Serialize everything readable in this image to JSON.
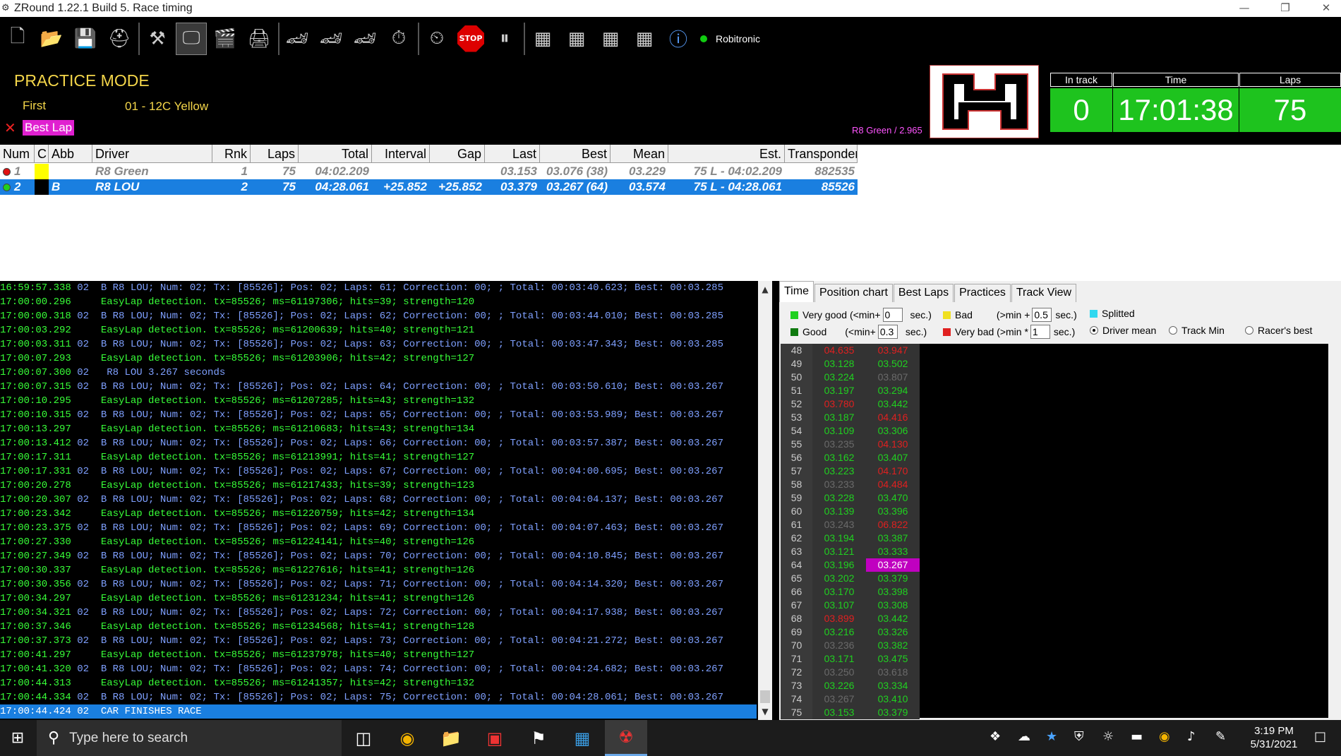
{
  "window": {
    "title": "ZRound 1.22.1 Build 5. Race timing"
  },
  "toolbar": {
    "icons": [
      "new-icon",
      "open-folder-icon",
      "save-icon",
      "helmet-icon",
      "hammer-icon",
      "monitor-icon",
      "clapper-icon",
      "printer-icon",
      "car-chip-icon",
      "car-stack-icon",
      "car-settings-icon",
      "car-timer-icon",
      "stopwatch-icon"
    ],
    "stop_label": "STOP",
    "user": "Robitronic"
  },
  "header": {
    "mode": "PRACTICE MODE",
    "first_label": "First",
    "first_value": "01 - 12C Yellow",
    "best_lap_label": "Best Lap",
    "best_lap_info": "R8 Green / 2.965",
    "in_track_label": "In track",
    "in_track_value": "0",
    "time_label": "Time",
    "time_value": "17:01:38",
    "laps_label": "Laps",
    "laps_value": "75"
  },
  "grid": {
    "columns": [
      "Num",
      "C",
      "Abb",
      "Driver",
      "Rnk",
      "Laps",
      "Total",
      "Interval",
      "Gap",
      "Last",
      "Best",
      "Mean",
      "Est.",
      "Transponder"
    ],
    "rows": [
      {
        "num": "1",
        "color": "#ffff00",
        "abb": "",
        "driver": "R8 Green",
        "rnk": "1",
        "laps": "75",
        "total": "04:02.209",
        "interval": "",
        "gap": "",
        "last": "03.153",
        "best": "03.076 (38)",
        "mean": "03.229",
        "est": "75 L - 04:02.209",
        "transponder": "882535",
        "status": "#e01010",
        "selected": false
      },
      {
        "num": "2",
        "color": "#000000",
        "abb": "B",
        "driver": "R8 LOU",
        "rnk": "2",
        "laps": "75",
        "total": "04:28.061",
        "interval": "+25.852",
        "gap": "+25.852",
        "last": "03.379",
        "best": "03.267 (64)",
        "mean": "03.574",
        "est": "75 L - 04:28.061",
        "transponder": "85526",
        "status": "#20d020",
        "selected": true
      }
    ]
  },
  "log": [
    {
      "t": "16:59:57.338",
      "m": " 02  B R8 LOU; Num: 02; Tx: [85526]; Pos: 02; Laps: 61; Correction: 00; ; Total: 00:03:40.623; Best: 00:03.285",
      "k": 1
    },
    {
      "t": "17:00:00.296",
      "m": "     EasyLap detection. tx=85526; ms=61197306; hits=39; strength=120",
      "k": 2
    },
    {
      "t": "17:00:00.318",
      "m": " 02  B R8 LOU; Num: 02; Tx: [85526]; Pos: 02; Laps: 62; Correction: 00; ; Total: 00:03:44.010; Best: 00:03.285",
      "k": 1
    },
    {
      "t": "17:00:03.292",
      "m": "     EasyLap detection. tx=85526; ms=61200639; hits=40; strength=121",
      "k": 2
    },
    {
      "t": "17:00:03.311",
      "m": " 02  B R8 LOU; Num: 02; Tx: [85526]; Pos: 02; Laps: 63; Correction: 00; ; Total: 00:03:47.343; Best: 00:03.285",
      "k": 1
    },
    {
      "t": "17:00:07.293",
      "m": "     EasyLap detection. tx=85526; ms=61203906; hits=42; strength=127",
      "k": 2
    },
    {
      "t": "17:00:07.300",
      "m": " 02   R8 LOU 3.267 seconds",
      "k": 1
    },
    {
      "t": "17:00:07.315",
      "m": " 02  B R8 LOU; Num: 02; Tx: [85526]; Pos: 02; Laps: 64; Correction: 00; ; Total: 00:03:50.610; Best: 00:03.267",
      "k": 1
    },
    {
      "t": "17:00:10.295",
      "m": "     EasyLap detection. tx=85526; ms=61207285; hits=43; strength=132",
      "k": 2
    },
    {
      "t": "17:00:10.315",
      "m": " 02  B R8 LOU; Num: 02; Tx: [85526]; Pos: 02; Laps: 65; Correction: 00; ; Total: 00:03:53.989; Best: 00:03.267",
      "k": 1
    },
    {
      "t": "17:00:13.297",
      "m": "     EasyLap detection. tx=85526; ms=61210683; hits=43; strength=134",
      "k": 2
    },
    {
      "t": "17:00:13.412",
      "m": " 02  B R8 LOU; Num: 02; Tx: [85526]; Pos: 02; Laps: 66; Correction: 00; ; Total: 00:03:57.387; Best: 00:03.267",
      "k": 1
    },
    {
      "t": "17:00:17.311",
      "m": "     EasyLap detection. tx=85526; ms=61213991; hits=41; strength=127",
      "k": 2
    },
    {
      "t": "17:00:17.331",
      "m": " 02  B R8 LOU; Num: 02; Tx: [85526]; Pos: 02; Laps: 67; Correction: 00; ; Total: 00:04:00.695; Best: 00:03.267",
      "k": 1
    },
    {
      "t": "17:00:20.278",
      "m": "     EasyLap detection. tx=85526; ms=61217433; hits=39; strength=123",
      "k": 2
    },
    {
      "t": "17:00:20.307",
      "m": " 02  B R8 LOU; Num: 02; Tx: [85526]; Pos: 02; Laps: 68; Correction: 00; ; Total: 00:04:04.137; Best: 00:03.267",
      "k": 1
    },
    {
      "t": "17:00:23.342",
      "m": "     EasyLap detection. tx=85526; ms=61220759; hits=42; strength=134",
      "k": 2
    },
    {
      "t": "17:00:23.375",
      "m": " 02  B R8 LOU; Num: 02; Tx: [85526]; Pos: 02; Laps: 69; Correction: 00; ; Total: 00:04:07.463; Best: 00:03.267",
      "k": 1
    },
    {
      "t": "17:00:27.330",
      "m": "     EasyLap detection. tx=85526; ms=61224141; hits=40; strength=126",
      "k": 2
    },
    {
      "t": "17:00:27.349",
      "m": " 02  B R8 LOU; Num: 02; Tx: [85526]; Pos: 02; Laps: 70; Correction: 00; ; Total: 00:04:10.845; Best: 00:03.267",
      "k": 1
    },
    {
      "t": "17:00:30.337",
      "m": "     EasyLap detection. tx=85526; ms=61227616; hits=41; strength=126",
      "k": 2
    },
    {
      "t": "17:00:30.356",
      "m": " 02  B R8 LOU; Num: 02; Tx: [85526]; Pos: 02; Laps: 71; Correction: 00; ; Total: 00:04:14.320; Best: 00:03.267",
      "k": 1
    },
    {
      "t": "17:00:34.297",
      "m": "     EasyLap detection. tx=85526; ms=61231234; hits=41; strength=126",
      "k": 2
    },
    {
      "t": "17:00:34.321",
      "m": " 02  B R8 LOU; Num: 02; Tx: [85526]; Pos: 02; Laps: 72; Correction: 00; ; Total: 00:04:17.938; Best: 00:03.267",
      "k": 1
    },
    {
      "t": "17:00:37.346",
      "m": "     EasyLap detection. tx=85526; ms=61234568; hits=41; strength=128",
      "k": 2
    },
    {
      "t": "17:00:37.373",
      "m": " 02  B R8 LOU; Num: 02; Tx: [85526]; Pos: 02; Laps: 73; Correction: 00; ; Total: 00:04:21.272; Best: 00:03.267",
      "k": 1
    },
    {
      "t": "17:00:41.297",
      "m": "     EasyLap detection. tx=85526; ms=61237978; hits=40; strength=127",
      "k": 2
    },
    {
      "t": "17:00:41.320",
      "m": " 02  B R8 LOU; Num: 02; Tx: [85526]; Pos: 02; Laps: 74; Correction: 00; ; Total: 00:04:24.682; Best: 00:03.267",
      "k": 1
    },
    {
      "t": "17:00:44.313",
      "m": "     EasyLap detection. tx=85526; ms=61241357; hits=42; strength=132",
      "k": 2
    },
    {
      "t": "17:00:44.334",
      "m": " 02  B R8 LOU; Num: 02; Tx: [85526]; Pos: 02; Laps: 75; Correction: 00; ; Total: 00:04:28.061; Best: 00:03.267",
      "k": 1
    },
    {
      "t": "17:00:44.424",
      "m": " 02  CAR FINISHES RACE",
      "k": 3
    }
  ],
  "right_panel": {
    "tabs": [
      "Time",
      "Position chart",
      "Best Laps",
      "Practices",
      "Track View"
    ],
    "active_tab": 0,
    "legend": {
      "very_good": "Very good (<min+",
      "very_good_val": "0",
      "good": "Good",
      "good_mid": "(<min+",
      "good_val": "0.3",
      "bad": "Bad",
      "bad_mid": "(>min +",
      "bad_val": "0.5",
      "very_bad": "Very bad (>min *",
      "very_bad_val": "1",
      "sec": "sec.)",
      "splitted": "Splitted",
      "driver_mean": "Driver mean",
      "track_min": "Track Min",
      "racers_best": "Racer's best"
    },
    "colors": {
      "very_good": "#20d020",
      "good": "#0f7a0f",
      "bad": "#f0e020",
      "very_bad": "#e02020",
      "splitted": "#30d8f0",
      "best": "#c000c0",
      "gray": "#6a6a6a"
    },
    "laps": [
      {
        "n": "48",
        "a": "04.635",
        "ac": "r",
        "b": "03.947",
        "bc": "r"
      },
      {
        "n": "49",
        "a": "03.128",
        "ac": "g",
        "b": "03.502",
        "bc": "g"
      },
      {
        "n": "50",
        "a": "03.224",
        "ac": "g",
        "b": "03.807",
        "bc": "d"
      },
      {
        "n": "51",
        "a": "03.197",
        "ac": "g",
        "b": "03.294",
        "bc": "g"
      },
      {
        "n": "52",
        "a": "03.780",
        "ac": "r",
        "b": "03.442",
        "bc": "g"
      },
      {
        "n": "53",
        "a": "03.187",
        "ac": "g",
        "b": "04.416",
        "bc": "r"
      },
      {
        "n": "54",
        "a": "03.109",
        "ac": "g",
        "b": "03.306",
        "bc": "g"
      },
      {
        "n": "55",
        "a": "03.235",
        "ac": "d",
        "b": "04.130",
        "bc": "r"
      },
      {
        "n": "56",
        "a": "03.162",
        "ac": "g",
        "b": "03.407",
        "bc": "g"
      },
      {
        "n": "57",
        "a": "03.223",
        "ac": "g",
        "b": "04.170",
        "bc": "r"
      },
      {
        "n": "58",
        "a": "03.233",
        "ac": "d",
        "b": "04.484",
        "bc": "r"
      },
      {
        "n": "59",
        "a": "03.228",
        "ac": "g",
        "b": "03.470",
        "bc": "g"
      },
      {
        "n": "60",
        "a": "03.139",
        "ac": "g",
        "b": "03.396",
        "bc": "g"
      },
      {
        "n": "61",
        "a": "03.243",
        "ac": "d",
        "b": "06.822",
        "bc": "r"
      },
      {
        "n": "62",
        "a": "03.194",
        "ac": "g",
        "b": "03.387",
        "bc": "g"
      },
      {
        "n": "63",
        "a": "03.121",
        "ac": "g",
        "b": "03.333",
        "bc": "g"
      },
      {
        "n": "64",
        "a": "03.196",
        "ac": "g",
        "b": "03.267",
        "bc": "m"
      },
      {
        "n": "65",
        "a": "03.202",
        "ac": "g",
        "b": "03.379",
        "bc": "g"
      },
      {
        "n": "66",
        "a": "03.170",
        "ac": "g",
        "b": "03.398",
        "bc": "g"
      },
      {
        "n": "67",
        "a": "03.107",
        "ac": "g",
        "b": "03.308",
        "bc": "g"
      },
      {
        "n": "68",
        "a": "03.899",
        "ac": "r",
        "b": "03.442",
        "bc": "g"
      },
      {
        "n": "69",
        "a": "03.216",
        "ac": "g",
        "b": "03.326",
        "bc": "g"
      },
      {
        "n": "70",
        "a": "03.236",
        "ac": "d",
        "b": "03.382",
        "bc": "g"
      },
      {
        "n": "71",
        "a": "03.171",
        "ac": "g",
        "b": "03.475",
        "bc": "g"
      },
      {
        "n": "72",
        "a": "03.250",
        "ac": "d",
        "b": "03.618",
        "bc": "d"
      },
      {
        "n": "73",
        "a": "03.226",
        "ac": "g",
        "b": "03.334",
        "bc": "g"
      },
      {
        "n": "74",
        "a": "03.267",
        "ac": "d",
        "b": "03.410",
        "bc": "g"
      },
      {
        "n": "75",
        "a": "03.153",
        "ac": "g",
        "b": "03.379",
        "bc": "g"
      }
    ]
  },
  "taskbar": {
    "search_placeholder": "Type here to search",
    "time": "3:19 PM",
    "date": "5/31/2021"
  }
}
